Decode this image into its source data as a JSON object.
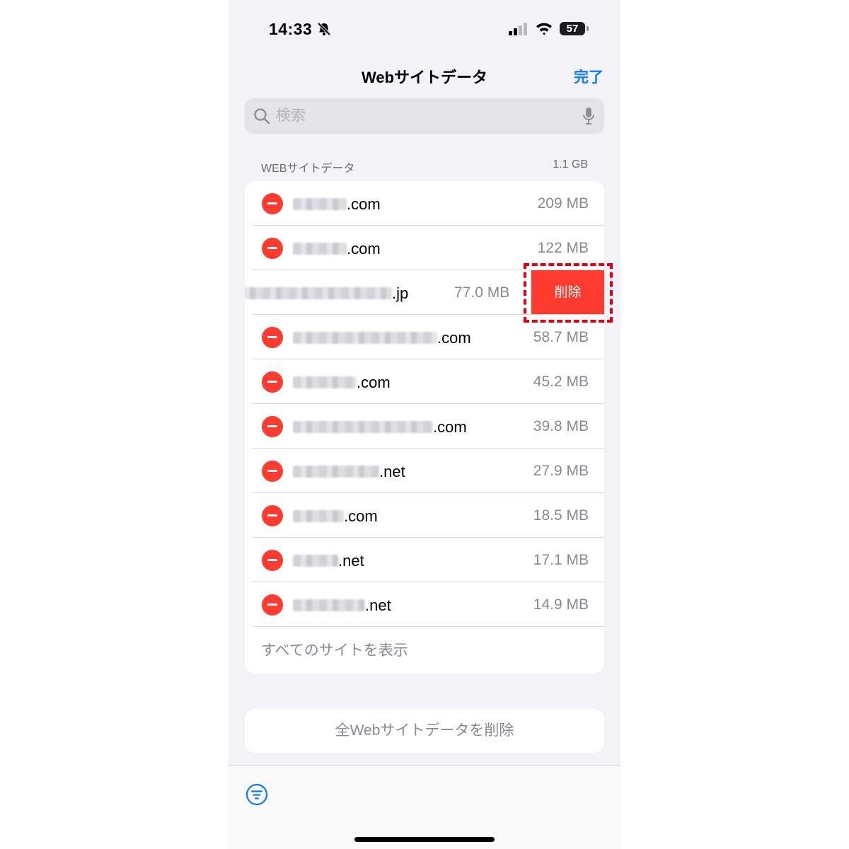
{
  "status_bar": {
    "time": "14:33",
    "battery": "57"
  },
  "nav": {
    "title": "Webサイトデータ",
    "done_label": "完了"
  },
  "search": {
    "placeholder": "検索"
  },
  "section": {
    "label": "WEBサイトデータ",
    "total": "1.1 GB"
  },
  "sites": [
    {
      "domain_suffix": ".com",
      "size": "209 MB"
    },
    {
      "domain_suffix": ".com",
      "size": "122 MB"
    },
    {
      "domain_suffix": ".jp",
      "size": "77.0 MB",
      "swiped": true,
      "delete_label": "削除"
    },
    {
      "domain_suffix": ".com",
      "size": "58.7 MB"
    },
    {
      "domain_suffix": ".com",
      "size": "45.2 MB"
    },
    {
      "domain_suffix": ".com",
      "size": "39.8 MB"
    },
    {
      "domain_suffix": ".net",
      "size": "27.9 MB"
    },
    {
      "domain_suffix": ".com",
      "size": "18.5 MB"
    },
    {
      "domain_suffix": ".net",
      "size": "17.1 MB"
    },
    {
      "domain_suffix": ".net",
      "size": "14.9 MB"
    }
  ],
  "show_all_label": "すべてのサイトを表示",
  "remove_all_label": "全Webサイトデータを削除",
  "colors": {
    "accent": "#0a7aff",
    "destructive": "#ff3b30",
    "highlight": "#e60012"
  },
  "icons": [
    "bell-slash-icon",
    "cellular-signal-icon",
    "wifi-icon",
    "battery-icon",
    "search-icon",
    "microphone-icon",
    "minus-circle-icon",
    "filter-icon"
  ]
}
